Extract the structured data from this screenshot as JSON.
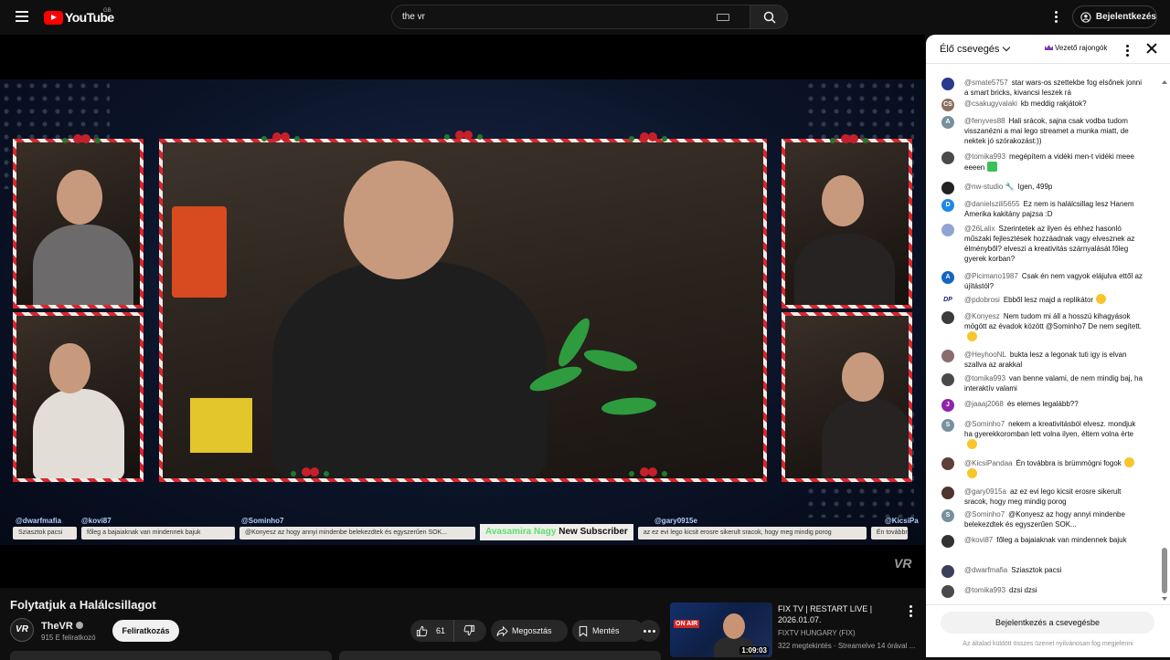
{
  "header": {
    "logo_text": "YouTube",
    "region": "GB",
    "search_value": "the vr",
    "signin_label": "Bejelentkezés"
  },
  "video": {
    "overlay_usernames": [
      "@dwarfmafia",
      "@kovi87",
      "@Sominho7",
      "@gary0915e",
      "@KicsiPa"
    ],
    "ticker_messages": [
      "Sziasztok pacsi",
      "főleg a bajaiaknak van mindennek bajuk",
      "@Konyesz az hogy annyi mindenbe belekezdtek és egyszerűen SOK...",
      "az ez evi lego kicsit erosre sikerult sracok, hogy meg mindig porog",
      "Én továbbra"
    ],
    "new_subscriber_name": "Avasamira Nagy",
    "new_subscriber_label": "New Subscriber",
    "watermark": "VR"
  },
  "meta": {
    "title": "Folytatjuk a Halálcsillagot",
    "channel_avatar": "VR",
    "channel_name": "TheVR",
    "subscribers": "915 E feliratkozó",
    "subscribe_label": "Feliratkozás",
    "likes": "61",
    "share_label": "Megosztás",
    "save_label": "Mentés"
  },
  "recommended": {
    "title": "FIX TV | RESTART LIVE | 2026.01.07.",
    "channel": "FIXTV HUNGARY (FIX)",
    "meta": "322 megtekintés · Streamelve 14 órával ...",
    "duration": "1:09:03",
    "badge": "ON AIR"
  },
  "chat": {
    "title": "Élő csevegés",
    "top_fans": "Vezető rajongók",
    "signin_label": "Bejelentkezés a csevegésbe",
    "note": "Az általad küldött összes üzenet nyilvánosan fog megjelenni",
    "messages": [
      {
        "author": "@smate5757",
        "text": "star wars-os szettekbe fog elsőnek jonni a smart bricks, kivancsi leszek rá",
        "avatar": "",
        "color": "#2b3a8c"
      },
      {
        "author": "@csakugyvalaki",
        "text": "kb meddig rakjátok?",
        "avatar": "CS",
        "color": "#8d6e63"
      },
      {
        "author": "@fenyves88",
        "text": "Hali srácok, sajna csak vodba tudom visszanézni a mai lego streamet a munka miatt, de nektek jó szórakozást:))",
        "avatar": "A",
        "color": "#78909c"
      },
      {
        "author": "@tomika993",
        "text": "megépítem a vidéki men-t vidéki meee eeeen",
        "avatar": "",
        "color": "#4a4a4a"
      },
      {
        "author": "@nw-studio 🔧",
        "text": "Igen, 499p",
        "avatar": "",
        "color": "#222222"
      },
      {
        "author": "@danielszili5655",
        "text": "Ez nem is halálcsillag lesz Hanem Amerika kakitány pajzsa :D",
        "avatar": "D",
        "color": "#1e88e5"
      },
      {
        "author": "@26Lalix",
        "text": "Szerintetek az ilyen és ehhez hasonló műszaki fejlesztések hozzáadnak vagy elvesznek az élményből? elveszi a kreativitás szárnyalását főleg gyerek korban?",
        "avatar": "",
        "color": "#90a4d4"
      },
      {
        "author": "@Picimano1987",
        "text": "Csak én nem vagyok elájulva ettől az újítástól?",
        "avatar": "A",
        "color": "#1565c0"
      },
      {
        "author": "@pdobrosi",
        "text": "Ebből lesz majd a replikátor",
        "avatar": "DP",
        "color": "#ffffff"
      },
      {
        "author": "@Konyesz",
        "text": "Nem tudom mi áll a hosszú kihagyások mögött az évadok között @Sominho7 De nem segített.",
        "avatar": "",
        "color": "#3b3b3b"
      },
      {
        "author": "@HeyhooNL",
        "text": "bukta lesz a legonak tuti igy is elvan szallva az arakkal",
        "avatar": "",
        "color": "#8a6d6d"
      },
      {
        "author": "@tomika993",
        "text": "van benne valami, de nem mindig baj, ha interaktív valami",
        "avatar": "",
        "color": "#4a4a4a"
      },
      {
        "author": "@jaaaj2068",
        "text": "és elemes legalább??",
        "avatar": "J",
        "color": "#8e24aa"
      },
      {
        "author": "@Sominho7",
        "text": "nekem a kreativitásból elvesz. mondjuk ha gyerekkoromban lett volna ilyen, éltem volna érte",
        "avatar": "S",
        "color": "#78909c"
      },
      {
        "author": "@KicsiPandaa",
        "text": "Én továbbra is brümmögni fogok",
        "avatar": "",
        "color": "#5d4037"
      },
      {
        "author": "@gary0915a",
        "text": "az ez evi lego kicsit erosre sikerult sracok, hogy meg mindig porog",
        "avatar": "",
        "color": "#4e342e"
      },
      {
        "author": "@Sominho7",
        "text": "@Konyesz az hogy annyi mindenbe belekezdtek és egyszerűen SOK...",
        "avatar": "S",
        "color": "#78909c"
      },
      {
        "author": "@kovi87",
        "text": "főleg a bajaiaknak van mindennek bajuk",
        "avatar": "",
        "color": "#333333"
      },
      {
        "author": "@dwarfmafia",
        "text": "Sziasztok pacsi",
        "avatar": "",
        "color": "#3a3f5c"
      },
      {
        "author": "@tomika993",
        "text": "dzsi dzsi",
        "avatar": "",
        "color": "#4a4a4a"
      }
    ]
  }
}
